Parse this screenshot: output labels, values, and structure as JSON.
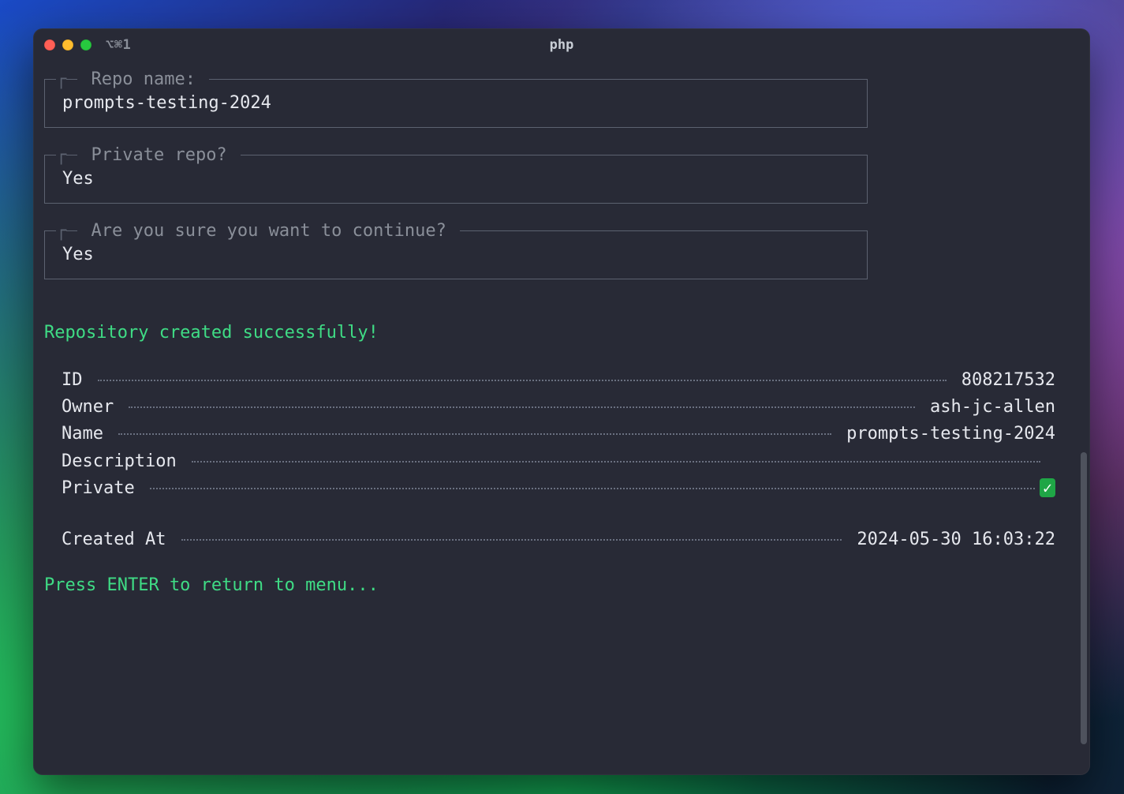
{
  "window": {
    "shortcut": "⌥⌘1",
    "title": "php"
  },
  "prompts": [
    {
      "label": "Repo name:",
      "value": "prompts-testing-2024"
    },
    {
      "label": "Private repo?",
      "value": "Yes"
    },
    {
      "label": "Are you sure you want to continue?",
      "value": "Yes"
    }
  ],
  "success_message": "Repository created successfully!",
  "details": [
    {
      "label": "ID",
      "value": "808217532"
    },
    {
      "label": "Owner",
      "value": "ash-jc-allen"
    },
    {
      "label": "Name",
      "value": "prompts-testing-2024"
    },
    {
      "label": "Description",
      "value": ""
    },
    {
      "label": "Private",
      "value": "✅",
      "check": true
    }
  ],
  "details2": [
    {
      "label": "Created At",
      "value": "2024-05-30 16:03:22"
    }
  ],
  "footer_message": "Press ENTER to return to menu..."
}
